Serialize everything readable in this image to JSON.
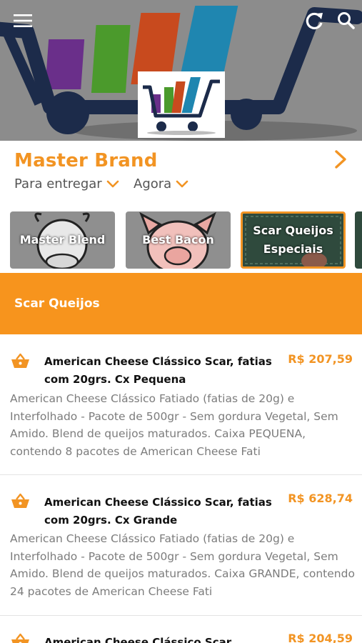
{
  "topbar": {
    "menu_icon": "hamburger-menu-icon",
    "refresh_icon": "refresh-icon",
    "search_icon": "search-icon"
  },
  "store": {
    "name": "Master Brand",
    "delivery_option": "Para entregar",
    "time_option": "Agora",
    "accent_color": "#f29423"
  },
  "categories": [
    {
      "label": "Master Blend",
      "selected": false
    },
    {
      "label": "Best Bacon",
      "selected": false
    },
    {
      "label": "Scar Queijos Especiais",
      "selected": true
    }
  ],
  "section": {
    "title": "Scar Queijos"
  },
  "products": [
    {
      "name": "American Cheese Clássico Scar, fatias com 20grs. Cx Pequena",
      "price": "R$ 207,59",
      "description": "American Cheese Clássico Fatiado (fatias de 20g) e Interfolhado - Pacote de 500gr - Sem gordura Vegetal, Sem Amido. Blend de queijos maturados. Caixa PEQUENA, contendo 8 pacotes de American Cheese Fati"
    },
    {
      "name": "American Cheese Clássico Scar, fatias com 20grs. Cx Grande",
      "price": "R$ 628,74",
      "description": "American Cheese Clássico Fatiado (fatias de 20g) e Interfolhado - Pacote de 500gr - Sem gordura Vegetal, Sem Amido. Blend de queijos maturados. Caixa GRANDE, contendo 24 pacotes de American Cheese Fati"
    },
    {
      "name": "American Cheese Clássico Scar",
      "price": "R$ 204,59",
      "description": ""
    }
  ]
}
